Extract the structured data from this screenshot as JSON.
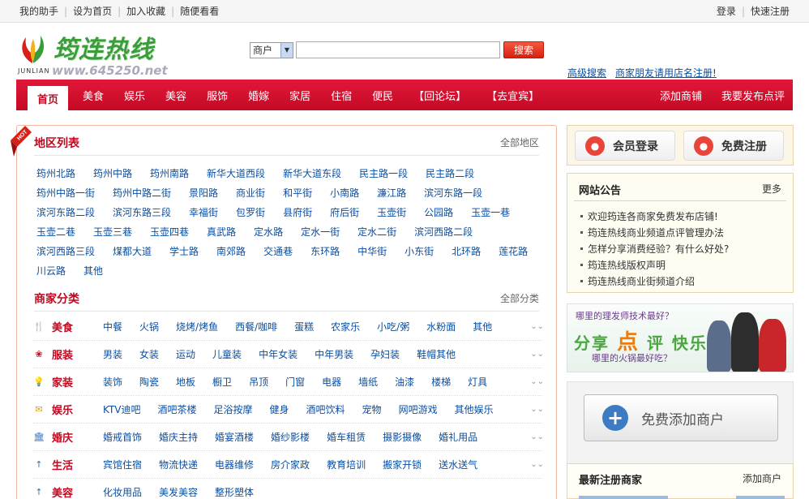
{
  "topbar": {
    "left": [
      "我的助手",
      "设为首页",
      "加入收藏",
      "随便看看"
    ],
    "right": [
      "登录",
      "快速注册"
    ]
  },
  "logo": {
    "text": "筠连热线",
    "english": "JUNLIAN",
    "url": "www.645250.net"
  },
  "search": {
    "category": "商户",
    "value": "",
    "button": "搜索"
  },
  "header_links": [
    "高级搜索",
    "商家朋友请用店名注册!"
  ],
  "nav": {
    "items": [
      "首页",
      "美食",
      "娱乐",
      "美容",
      "服饰",
      "婚嫁",
      "家居",
      "住宿",
      "便民",
      "【回论坛】",
      "【去宜宾】"
    ],
    "right": [
      "添加商铺",
      "我要发布点评"
    ]
  },
  "areas": {
    "title": "地区列表",
    "more": "全部地区",
    "rows": [
      [
        "筠州北路",
        "筠州中路",
        "筠州南路",
        "新华大道西段",
        "新华大道东段",
        "民主路一段",
        "民主路二段"
      ],
      [
        "筠州中路一街",
        "筠州中路二街",
        "景阳路",
        "商业街",
        "和平街",
        "小南路",
        "濂江路",
        "滨河东路一段"
      ],
      [
        "滨河东路二段",
        "滨河东路三段",
        "幸福街",
        "包罗街",
        "县府街",
        "府后街",
        "玉壶街",
        "公园路",
        "玉壶一巷"
      ],
      [
        "玉壶二巷",
        "玉壶三巷",
        "玉壶四巷",
        "真武路",
        "定水路",
        "定水一街",
        "定水二街",
        "滨河西路二段"
      ],
      [
        "滨河西路三段",
        "煤都大道",
        "学士路",
        "南郊路",
        "交通巷",
        "东环路",
        "中华街",
        "小东街",
        "北环路",
        "莲花路"
      ],
      [
        "川云路",
        "其他"
      ]
    ]
  },
  "categories": {
    "title": "商家分类",
    "more": "全部分类",
    "items": [
      {
        "name": "美食",
        "icon": "fork-knife-icon",
        "links": [
          "中餐",
          "火锅",
          "烧烤/烤鱼",
          "西餐/咖啡",
          "蛋糕",
          "农家乐",
          "小吃/粥",
          "水粉面",
          "其他"
        ]
      },
      {
        "name": "服装",
        "icon": "shirt-icon",
        "links": [
          "男装",
          "女装",
          "运动",
          "儿童装",
          "中年女装",
          "中年男装",
          "孕妇装",
          "鞋帽其他"
        ]
      },
      {
        "name": "家装",
        "icon": "lightbulb-icon",
        "links": [
          "装饰",
          "陶瓷",
          "地板",
          "橱卫",
          "吊顶",
          "门窗",
          "电器",
          "墙纸",
          "油漆",
          "楼梯",
          "灯具"
        ]
      },
      {
        "name": "娱乐",
        "icon": "envelope-icon",
        "links": [
          "KTV迪吧",
          "酒吧茶楼",
          "足浴按摩",
          "健身",
          "酒吧饮料",
          "宠物",
          "网吧游戏",
          "其他娱乐"
        ]
      },
      {
        "name": "婚庆",
        "icon": "building-icon",
        "links": [
          "婚戒首饰",
          "婚庆主持",
          "婚宴酒楼",
          "婚纱影楼",
          "婚车租赁",
          "摄影摄像",
          "婚礼用品"
        ]
      },
      {
        "name": "生活",
        "icon": "arrow-up-icon",
        "links": [
          "宾馆住宿",
          "物流快递",
          "电器维修",
          "房介家政",
          "教育培训",
          "搬家开锁",
          "送水送气"
        ]
      },
      {
        "name": "美容",
        "icon": "arrow-up-icon",
        "links": [
          "化妆用品",
          "美发美容",
          "整形塑体"
        ]
      }
    ]
  },
  "login": {
    "member": "会员登录",
    "register": "免费注册"
  },
  "notice": {
    "title": "网站公告",
    "more": "更多",
    "items": [
      "欢迎筠连各商家免费发布店铺!",
      "筠连热线商业频道点评管理办法",
      "怎样分享消费经验？有什么好处?",
      "筠连热线版权声明",
      "筠连热线商业街频道介绍"
    ]
  },
  "banner": {
    "q1": "哪里的理发师技术最好？",
    "main_a": "分享",
    "main_b": "点",
    "main_c": "评 快乐",
    "q2": "哪里的火锅最好吃？"
  },
  "add_shop": {
    "label": "免费添加商户"
  },
  "new_reg": {
    "title": "最新注册商家",
    "more": "添加商户"
  },
  "colors": {
    "brand_red": "#c30a24",
    "link_blue": "#0a4fa3",
    "logo_green": "#3a9d3a"
  }
}
